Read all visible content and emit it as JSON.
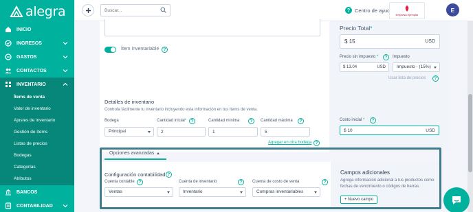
{
  "app": {
    "logo_text": "alegra"
  },
  "sidebar": {
    "items": [
      {
        "label": "INICIO",
        "icon": "home-icon"
      },
      {
        "label": "INGRESOS",
        "icon": "income-icon"
      },
      {
        "label": "GASTOS",
        "icon": "expenses-icon"
      },
      {
        "label": "CONTACTOS",
        "icon": "contacts-icon"
      },
      {
        "label": "INVENTARIO",
        "icon": "inventory-icon"
      },
      {
        "label": "BANCOS",
        "icon": "bank-icon"
      },
      {
        "label": "CONTABILIDAD",
        "icon": "accounting-icon"
      }
    ],
    "submenu": [
      "Ítems de venta",
      "Valor de inventario",
      "Ajustes de inventario",
      "Gestión de ítems",
      "Listas de precios",
      "Bodegas",
      "Categorías",
      "Atributos"
    ]
  },
  "topbar": {
    "search_placeholder": "Buscar...",
    "help_label": "Centro de ayuda",
    "company_label": "Empresa Ejemplar",
    "avatar_initial": "E"
  },
  "form": {
    "toggle_label": "Ítem inventariable",
    "inventory_title": "Detalles de inventario",
    "inventory_subtitle": "Controla fácilmente tu inventario incluyendo esta información en tus ítems de venta.",
    "bodega_label": "Bodega",
    "bodega_value": "Principal",
    "cantidad_inicial_label": "Cantidad inicial",
    "cantidad_inicial_value": "2",
    "cantidad_minima_label": "Cantidad mínima",
    "cantidad_minima_value": "1",
    "cantidad_maxima_label": "Cantidad máxima",
    "cantidad_maxima_value": "5",
    "agregar_bodega_link": "Agregar en otra bodega",
    "required_mark": "*",
    "help_glyph": "?"
  },
  "pricing": {
    "precio_total_label": "Precio Total",
    "currency_symbol": "$",
    "precio_total_value": "15",
    "currency_code": "USD",
    "precio_sin_impuesto_label": "Precio sin impuesto",
    "precio_sin_impuesto_value": "13.04",
    "impuesto_label": "Impuesto",
    "impuesto_value": "Impuesto - (15%)",
    "usar_lista_link": "Usar lista de precios",
    "costo_inicial_label": "Costo inicial",
    "costo_inicial_value": "10"
  },
  "advanced": {
    "header_label": "Opciones avanzadas",
    "config_title": "Configuración contabilidad",
    "cuenta_contable_label": "Cuenta contable",
    "cuenta_contable_value": "Ventas",
    "cuenta_inventario_label": "Cuenta de inventario",
    "cuenta_inventario_value": "Inventario",
    "cuenta_costo_label": "Cuenta de costo de venta",
    "cuenta_costo_value": "Compras inventariables",
    "campos_title": "Campos adicionales",
    "campos_desc": "Agrega información adicional a tus productos como fechas de vencimiento o códigos de barras.",
    "nuevo_campo_label": "+ Nuevo campo"
  },
  "colors": {
    "brand": "#00b19d",
    "brand_dark": "#06877a",
    "highlight": "#3f7b8c"
  }
}
